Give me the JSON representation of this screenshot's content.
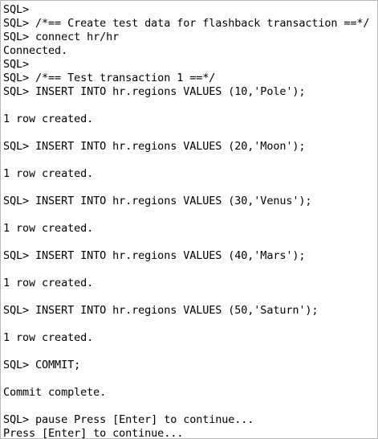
{
  "terminal": {
    "lines": [
      "SQL>",
      "SQL> /*== Create test data for flashback transaction ==*/",
      "SQL> connect hr/hr",
      "Connected.",
      "SQL>",
      "SQL> /*== Test transaction 1 ==*/",
      "SQL> INSERT INTO hr.regions VALUES (10,'Pole');",
      "",
      "1 row created.",
      "",
      "SQL> INSERT INTO hr.regions VALUES (20,'Moon');",
      "",
      "1 row created.",
      "",
      "SQL> INSERT INTO hr.regions VALUES (30,'Venus');",
      "",
      "1 row created.",
      "",
      "SQL> INSERT INTO hr.regions VALUES (40,'Mars');",
      "",
      "1 row created.",
      "",
      "SQL> INSERT INTO hr.regions VALUES (50,'Saturn');",
      "",
      "1 row created.",
      "",
      "SQL> COMMIT;",
      "",
      "Commit complete.",
      "",
      "SQL> pause Press [Enter] to continue...",
      "Press [Enter] to continue..."
    ]
  }
}
